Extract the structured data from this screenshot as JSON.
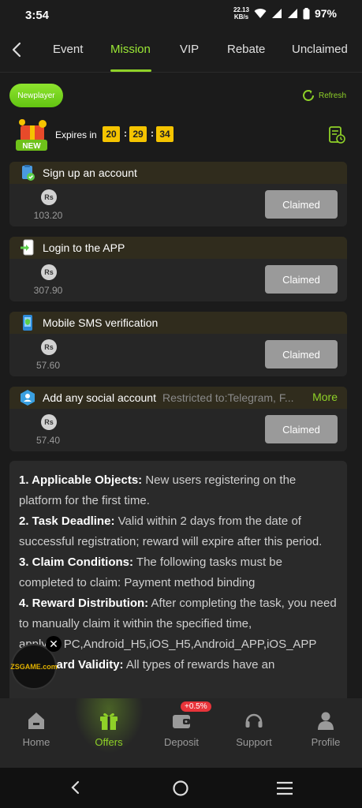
{
  "status_bar": {
    "time": "3:54",
    "net_speed_value": "22.13",
    "net_speed_unit": "KB/s",
    "battery": "97%"
  },
  "tabs": [
    {
      "label": "Event"
    },
    {
      "label": "Mission"
    },
    {
      "label": "VIP"
    },
    {
      "label": "Rebate"
    },
    {
      "label": "Unclaimed"
    }
  ],
  "active_tab": "Mission",
  "header": {
    "newplayer": "Newplayer",
    "refresh": "Refresh",
    "gift_badge": "NEW"
  },
  "countdown": {
    "label": "Expires in",
    "hours": "20",
    "minutes": "29",
    "seconds": "34"
  },
  "tasks": [
    {
      "title": "Sign up an account",
      "currency": "Rs",
      "amount": "103.20",
      "button": "Claimed"
    },
    {
      "title": "Login to the APP",
      "currency": "Rs",
      "amount": "307.90",
      "button": "Claimed"
    },
    {
      "title": "Mobile SMS verification",
      "currency": "Rs",
      "amount": "57.60",
      "button": "Claimed"
    },
    {
      "title": "Add any social account",
      "restriction": "Restricted to:Telegram, F...",
      "more": "More",
      "currency": "Rs",
      "amount": "57.40",
      "button": "Claimed"
    }
  ],
  "rules": [
    {
      "head": "1. Applicable Objects:",
      "body": " New users registering on the platform for the first time."
    },
    {
      "head": "2. Task Deadline:",
      "body": " Valid within 2 days from the date of successful registration; reward will expire after this period."
    },
    {
      "head": "3. Claim Conditions:",
      "body": " The following tasks must be completed to claim: Payment method binding"
    },
    {
      "head": "4. Reward Distribution:",
      "body": " After completing the task, you need to manually claim it within the specified time, "
    },
    {
      "head": "",
      "body": "apply to PC,Android_H5,iOS_H5,Android_APP,iOS_APP"
    },
    {
      "head": "5. Reward Validity:",
      "body": " All types of rewards have an"
    }
  ],
  "floating": {
    "logo_text": "ZSGAME.com",
    "close": "✕"
  },
  "bottom_nav": {
    "items": [
      {
        "label": "Home",
        "icon": "home-icon"
      },
      {
        "label": "Offers",
        "icon": "gift-icon"
      },
      {
        "label": "Deposit",
        "icon": "wallet-icon"
      },
      {
        "label": "Support",
        "icon": "headset-icon"
      },
      {
        "label": "Profile",
        "icon": "person-icon"
      }
    ],
    "active": "Offers",
    "deposit_badge": "+0.5%"
  },
  "colors": {
    "accent": "#8fd128",
    "countdown": "#f5c400",
    "badge": "#e8343a",
    "claimed": "#9a9a9a"
  }
}
